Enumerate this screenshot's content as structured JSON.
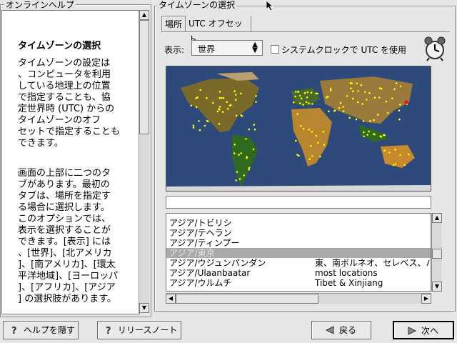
{
  "help": {
    "legend": "オンラインヘルプ",
    "title": "タイムゾーンの選択",
    "para1": [
      "タイムゾーンの設定は",
      "、コンピュータを利用",
      "している地理上の位置",
      "で指定することも、協",
      "定世界時 (UTC) からの",
      "タイムゾーンのオフ",
      "セットで指定することも",
      "できます。"
    ],
    "para2": [
      "画面の上部に二つのタ",
      "ブがあります。最初の",
      "タブは、場所を指定す",
      "る場合に選択します。",
      "このオプションでは、",
      "表示を選択することが",
      "できます。[表示] には",
      "、[世界]、[北アメリカ",
      "]、[南アメリカ]、[環太",
      "平洋地域]、[ヨーロッパ",
      "]、[アフリカ]、[アジア",
      "] の選択肢があります。"
    ]
  },
  "tz": {
    "legend": "タイムゾーンの選択",
    "tabs": [
      "場所",
      "UTC オフセット"
    ],
    "view_label": "表示:",
    "view_value": "世界",
    "system_clock_label": "システムクロックで UTC を使用",
    "system_clock_checked": false,
    "status": ""
  },
  "zones": [
    {
      "name": "アジア/トビリシ",
      "desc": ""
    },
    {
      "name": "アジア/テヘラン",
      "desc": ""
    },
    {
      "name": "アジア/ティンプー",
      "desc": ""
    },
    {
      "name": "アジア/東京",
      "desc": "",
      "selected": true
    },
    {
      "name": "アジア/ウジュンパンダン",
      "desc": "東、南ボルネオ、セレベス、バ"
    },
    {
      "name": "アジア/Ulaanbaatar",
      "desc": "most locations"
    },
    {
      "name": "アジア/ウルムチ",
      "desc": "Tibet & Xinjiang"
    }
  ],
  "buttons": {
    "hide_help": "ヘルプを隠す",
    "release_notes": "リリースノート",
    "back": "戻る",
    "next": "次へ"
  },
  "colors": {
    "selected_row": "#a9a9a9",
    "map_ocean": "#2e4a7a",
    "city_dot": "#ffff00",
    "selected_city": "#ff0000"
  }
}
